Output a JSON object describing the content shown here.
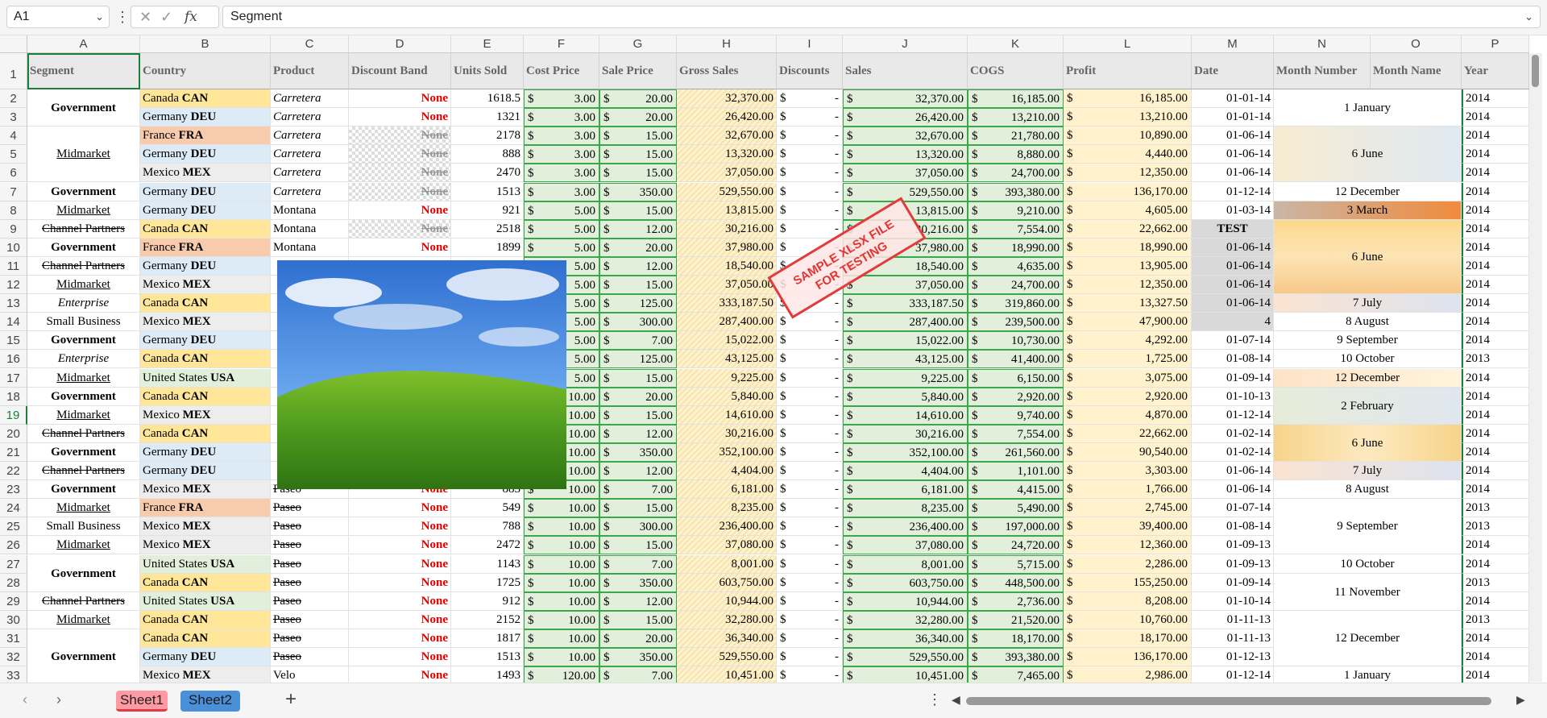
{
  "formula_bar": {
    "name_box": "A1",
    "formula": "Segment",
    "fx_label": "fx",
    "cancel_icon": "close-icon",
    "confirm_icon": "check-icon"
  },
  "columns": [
    "A",
    "B",
    "C",
    "D",
    "E",
    "F",
    "G",
    "H",
    "I",
    "J",
    "K",
    "L",
    "M",
    "N",
    "O",
    "P"
  ],
  "headers": [
    "Segment",
    "Country",
    "Product",
    "Discount Band",
    "Units Sold",
    "Cost Price",
    "Sale Price",
    "Gross Sales",
    "Discounts",
    "Sales",
    "COGS",
    "Profit",
    "Date",
    "Month Number",
    "Month Name",
    "Year"
  ],
  "rows": [
    {
      "n": "2",
      "seg": "Government",
      "country": "Canada",
      "code": "CAN",
      "product": "Carretera",
      "band": "None",
      "units": "1618.5",
      "cost": "3.00",
      "sale": "20.00",
      "gross": "32,370.00",
      "disc": "-",
      "sales": "32,370.00",
      "cogs": "16,185.00",
      "profit": "16,185.00",
      "date": "01-01-14",
      "year": "2014"
    },
    {
      "n": "3",
      "seg": "",
      "country": "Germany",
      "code": "DEU",
      "product": "Carretera",
      "band": "None",
      "units": "1321",
      "cost": "3.00",
      "sale": "20.00",
      "gross": "26,420.00",
      "disc": "-",
      "sales": "26,420.00",
      "cogs": "13,210.00",
      "profit": "13,210.00",
      "date": "01-01-14",
      "year": "2014"
    },
    {
      "n": "4",
      "seg": "",
      "country": "France",
      "code": "FRA",
      "product": "Carretera",
      "band": "None",
      "units": "2178",
      "cost": "3.00",
      "sale": "15.00",
      "gross": "32,670.00",
      "disc": "-",
      "sales": "32,670.00",
      "cogs": "21,780.00",
      "profit": "10,890.00",
      "date": "01-06-14",
      "year": "2014"
    },
    {
      "n": "5",
      "seg": "Midmarket",
      "country": "Germany",
      "code": "DEU",
      "product": "Carretera",
      "band": "None",
      "units": "888",
      "cost": "3.00",
      "sale": "15.00",
      "gross": "13,320.00",
      "disc": "-",
      "sales": "13,320.00",
      "cogs": "8,880.00",
      "profit": "4,440.00",
      "date": "01-06-14",
      "year": "2014"
    },
    {
      "n": "6",
      "seg": "",
      "country": "Mexico",
      "code": "MEX",
      "product": "Carretera",
      "band": "None",
      "units": "2470",
      "cost": "3.00",
      "sale": "15.00",
      "gross": "37,050.00",
      "disc": "-",
      "sales": "37,050.00",
      "cogs": "24,700.00",
      "profit": "12,350.00",
      "date": "01-06-14",
      "year": "2014"
    },
    {
      "n": "7",
      "seg": "Government",
      "country": "Germany",
      "code": "DEU",
      "product": "Carretera",
      "band": "None",
      "units": "1513",
      "cost": "3.00",
      "sale": "350.00",
      "gross": "529,550.00",
      "disc": "-",
      "sales": "529,550.00",
      "cogs": "393,380.00",
      "profit": "136,170.00",
      "date": "01-12-14",
      "year": "2014"
    },
    {
      "n": "8",
      "seg": "Midmarket",
      "country": "Germany",
      "code": "DEU",
      "product": "Montana",
      "band": "None",
      "units": "921",
      "cost": "5.00",
      "sale": "15.00",
      "gross": "13,815.00",
      "disc": "-",
      "sales": "13,815.00",
      "cogs": "9,210.00",
      "profit": "4,605.00",
      "date": "01-03-14",
      "year": "2014"
    },
    {
      "n": "9",
      "seg": "Channel Partners",
      "country": "Canada",
      "code": "CAN",
      "product": "Montana",
      "band": "None",
      "units": "2518",
      "cost": "5.00",
      "sale": "12.00",
      "gross": "30,216.00",
      "disc": "-",
      "sales": "30,216.00",
      "cogs": "7,554.00",
      "profit": "22,662.00",
      "date": "TEST",
      "year": "2014"
    },
    {
      "n": "10",
      "seg": "Government",
      "country": "France",
      "code": "FRA",
      "product": "Montana",
      "band": "None",
      "units": "1899",
      "cost": "5.00",
      "sale": "20.00",
      "gross": "37,980.00",
      "disc": "-",
      "sales": "37,980.00",
      "cogs": "18,990.00",
      "profit": "18,990.00",
      "date": "01-06-14",
      "year": "2014"
    },
    {
      "n": "11",
      "seg": "Channel Partners",
      "country": "Germany",
      "code": "DEU",
      "product": "",
      "band": "",
      "units": "",
      "cost": "5.00",
      "sale": "12.00",
      "gross": "18,540.00",
      "disc": "-",
      "sales": "18,540.00",
      "cogs": "4,635.00",
      "profit": "13,905.00",
      "date": "01-06-14",
      "year": "2014"
    },
    {
      "n": "12",
      "seg": "Midmarket",
      "country": "Mexico",
      "code": "MEX",
      "product": "",
      "band": "",
      "units": "",
      "cost": "5.00",
      "sale": "15.00",
      "gross": "37,050.00",
      "disc": "-",
      "sales": "37,050.00",
      "cogs": "24,700.00",
      "profit": "12,350.00",
      "date": "01-06-14",
      "year": "2014"
    },
    {
      "n": "13",
      "seg": "Enterprise",
      "country": "Canada",
      "code": "CAN",
      "product": "",
      "band": "",
      "units": "",
      "cost": "5.00",
      "sale": "125.00",
      "gross": "333,187.50",
      "disc": "-",
      "sales": "333,187.50",
      "cogs": "319,860.00",
      "profit": "13,327.50",
      "date": "01-06-14",
      "year": "2014"
    },
    {
      "n": "14",
      "seg": "Small Business",
      "country": "Mexico",
      "code": "MEX",
      "product": "",
      "band": "",
      "units": "",
      "cost": "5.00",
      "sale": "300.00",
      "gross": "287,400.00",
      "disc": "-",
      "sales": "287,400.00",
      "cogs": "239,500.00",
      "profit": "47,900.00",
      "date": "4",
      "year": "2014"
    },
    {
      "n": "15",
      "seg": "Government",
      "country": "Germany",
      "code": "DEU",
      "product": "",
      "band": "",
      "units": "",
      "cost": "5.00",
      "sale": "7.00",
      "gross": "15,022.00",
      "disc": "-",
      "sales": "15,022.00",
      "cogs": "10,730.00",
      "profit": "4,292.00",
      "date": "01-07-14",
      "year": "2014"
    },
    {
      "n": "16",
      "seg": "Enterprise",
      "country": "Canada",
      "code": "CAN",
      "product": "",
      "band": "",
      "units": "",
      "cost": "5.00",
      "sale": "125.00",
      "gross": "43,125.00",
      "disc": "-",
      "sales": "43,125.00",
      "cogs": "41,400.00",
      "profit": "1,725.00",
      "date": "01-08-14",
      "year": "2013"
    },
    {
      "n": "17",
      "seg": "Midmarket",
      "country": "United States",
      "code": "USA",
      "product": "",
      "band": "",
      "units": "",
      "cost": "5.00",
      "sale": "15.00",
      "gross": "9,225.00",
      "disc": "-",
      "sales": "9,225.00",
      "cogs": "6,150.00",
      "profit": "3,075.00",
      "date": "01-09-14",
      "year": "2014"
    },
    {
      "n": "18",
      "seg": "Government",
      "country": "Canada",
      "code": "CAN",
      "product": "",
      "band": "",
      "units": "",
      "cost": "10.00",
      "sale": "20.00",
      "gross": "5,840.00",
      "disc": "-",
      "sales": "5,840.00",
      "cogs": "2,920.00",
      "profit": "2,920.00",
      "date": "01-10-13",
      "year": "2014"
    },
    {
      "n": "19",
      "seg": "Midmarket",
      "country": "Mexico",
      "code": "MEX",
      "product": "",
      "band": "",
      "units": "",
      "cost": "10.00",
      "sale": "15.00",
      "gross": "14,610.00",
      "disc": "-",
      "sales": "14,610.00",
      "cogs": "9,740.00",
      "profit": "4,870.00",
      "date": "01-12-14",
      "year": "2014"
    },
    {
      "n": "20",
      "seg": "Channel Partners",
      "country": "Canada",
      "code": "CAN",
      "product": "",
      "band": "",
      "units": "",
      "cost": "10.00",
      "sale": "12.00",
      "gross": "30,216.00",
      "disc": "-",
      "sales": "30,216.00",
      "cogs": "7,554.00",
      "profit": "22,662.00",
      "date": "01-02-14",
      "year": "2014"
    },
    {
      "n": "21",
      "seg": "Government",
      "country": "Germany",
      "code": "DEU",
      "product": "",
      "band": "",
      "units": "",
      "cost": "10.00",
      "sale": "350.00",
      "gross": "352,100.00",
      "disc": "-",
      "sales": "352,100.00",
      "cogs": "261,560.00",
      "profit": "90,540.00",
      "date": "01-02-14",
      "year": "2014"
    },
    {
      "n": "22",
      "seg": "Channel Partners",
      "country": "Germany",
      "code": "DEU",
      "product": "",
      "band": "",
      "units": "",
      "cost": "10.00",
      "sale": "12.00",
      "gross": "4,404.00",
      "disc": "-",
      "sales": "4,404.00",
      "cogs": "1,101.00",
      "profit": "3,303.00",
      "date": "01-06-14",
      "year": "2014"
    },
    {
      "n": "23",
      "seg": "Government",
      "country": "Mexico",
      "code": "MEX",
      "product": "Paseo",
      "band": "None",
      "units": "883",
      "cost": "10.00",
      "sale": "7.00",
      "gross": "6,181.00",
      "disc": "-",
      "sales": "6,181.00",
      "cogs": "4,415.00",
      "profit": "1,766.00",
      "date": "01-06-14",
      "year": "2014"
    },
    {
      "n": "24",
      "seg": "Midmarket",
      "country": "France",
      "code": "FRA",
      "product": "Paseo",
      "band": "None",
      "units": "549",
      "cost": "10.00",
      "sale": "15.00",
      "gross": "8,235.00",
      "disc": "-",
      "sales": "8,235.00",
      "cogs": "5,490.00",
      "profit": "2,745.00",
      "date": "01-07-14",
      "year": "2013"
    },
    {
      "n": "25",
      "seg": "Small Business",
      "country": "Mexico",
      "code": "MEX",
      "product": "Paseo",
      "band": "None",
      "units": "788",
      "cost": "10.00",
      "sale": "300.00",
      "gross": "236,400.00",
      "disc": "-",
      "sales": "236,400.00",
      "cogs": "197,000.00",
      "profit": "39,400.00",
      "date": "01-08-14",
      "year": "2013"
    },
    {
      "n": "26",
      "seg": "Midmarket",
      "country": "Mexico",
      "code": "MEX",
      "product": "Paseo",
      "band": "None",
      "units": "2472",
      "cost": "10.00",
      "sale": "15.00",
      "gross": "37,080.00",
      "disc": "-",
      "sales": "37,080.00",
      "cogs": "24,720.00",
      "profit": "12,360.00",
      "date": "01-09-13",
      "year": "2014"
    },
    {
      "n": "27",
      "seg": "",
      "country": "United States",
      "code": "USA",
      "product": "Paseo",
      "band": "None",
      "units": "1143",
      "cost": "10.00",
      "sale": "7.00",
      "gross": "8,001.00",
      "disc": "-",
      "sales": "8,001.00",
      "cogs": "5,715.00",
      "profit": "2,286.00",
      "date": "01-09-13",
      "year": "2014"
    },
    {
      "n": "28",
      "seg": "",
      "country": "Canada",
      "code": "CAN",
      "product": "Paseo",
      "band": "None",
      "units": "1725",
      "cost": "10.00",
      "sale": "350.00",
      "gross": "603,750.00",
      "disc": "-",
      "sales": "603,750.00",
      "cogs": "448,500.00",
      "profit": "155,250.00",
      "date": "01-09-14",
      "year": "2013"
    },
    {
      "n": "29",
      "seg": "Channel Partners",
      "country": "United States",
      "code": "USA",
      "product": "Paseo",
      "band": "None",
      "units": "912",
      "cost": "10.00",
      "sale": "12.00",
      "gross": "10,944.00",
      "disc": "-",
      "sales": "10,944.00",
      "cogs": "2,736.00",
      "profit": "8,208.00",
      "date": "01-10-14",
      "year": "2014"
    },
    {
      "n": "30",
      "seg": "Midmarket",
      "country": "Canada",
      "code": "CAN",
      "product": "Paseo",
      "band": "None",
      "units": "2152",
      "cost": "10.00",
      "sale": "15.00",
      "gross": "32,280.00",
      "disc": "-",
      "sales": "32,280.00",
      "cogs": "21,520.00",
      "profit": "10,760.00",
      "date": "01-11-13",
      "year": "2013"
    },
    {
      "n": "31",
      "seg": "",
      "country": "Canada",
      "code": "CAN",
      "product": "Paseo",
      "band": "None",
      "units": "1817",
      "cost": "10.00",
      "sale": "20.00",
      "gross": "36,340.00",
      "disc": "-",
      "sales": "36,340.00",
      "cogs": "18,170.00",
      "profit": "18,170.00",
      "date": "01-11-13",
      "year": "2014"
    },
    {
      "n": "32",
      "seg": "",
      "country": "Germany",
      "code": "DEU",
      "product": "Paseo",
      "band": "None",
      "units": "1513",
      "cost": "10.00",
      "sale": "350.00",
      "gross": "529,550.00",
      "disc": "-",
      "sales": "529,550.00",
      "cogs": "393,380.00",
      "profit": "136,170.00",
      "date": "01-12-13",
      "year": "2014"
    },
    {
      "n": "33",
      "seg": "",
      "country": "Mexico",
      "code": "MEX",
      "product": "Velo",
      "band": "None",
      "units": "1493",
      "cost": "120.00",
      "sale": "7.00",
      "gross": "10,451.00",
      "disc": "-",
      "sales": "10,451.00",
      "cogs": "7,465.00",
      "profit": "2,986.00",
      "date": "01-12-14",
      "year": "2014"
    }
  ],
  "merged_segments": [
    {
      "text": "Government",
      "from": 2,
      "to": 3
    },
    {
      "text": "Midmarket",
      "from": 4,
      "to": 6
    },
    {
      "text": "Government",
      "from": 27,
      "to": 28
    },
    {
      "text": "Government",
      "from": 31,
      "to": 33
    }
  ],
  "months": [
    {
      "text": "1 January",
      "from": 2,
      "to": 3
    },
    {
      "text": "6 June",
      "from": 4,
      "to": 6
    },
    {
      "text": "12 December",
      "from": 7,
      "to": 7
    },
    {
      "text": "3 March",
      "from": 8,
      "to": 8
    },
    {
      "text": "6 June",
      "from": 9,
      "to": 12
    },
    {
      "text": "7 July",
      "from": 13,
      "to": 13
    },
    {
      "text": "8 August",
      "from": 14,
      "to": 14
    },
    {
      "text": "9 September",
      "from": 15,
      "to": 15
    },
    {
      "text": "10 October",
      "from": 16,
      "to": 16
    },
    {
      "text": "12 December",
      "from": 17,
      "to": 17
    },
    {
      "text": "2 February",
      "from": 18,
      "to": 19
    },
    {
      "text": "6 June",
      "from": 20,
      "to": 21
    },
    {
      "text": "7 July",
      "from": 22,
      "to": 22
    },
    {
      "text": "8 August",
      "from": 23,
      "to": 23
    },
    {
      "text": "9 September",
      "from": 24,
      "to": 26
    },
    {
      "text": "10 October",
      "from": 27,
      "to": 27
    },
    {
      "text": "11 November",
      "from": 28,
      "to": 29
    },
    {
      "text": "12 December",
      "from": 30,
      "to": 32
    },
    {
      "text": "1 January",
      "from": 33,
      "to": 33
    }
  ],
  "currency_symbol": "$",
  "stamp": {
    "line1": "SAMPLE XLSX FILE",
    "line2": "FOR TESTING"
  },
  "photo_icon": "landscape-image",
  "colors": {
    "canada": "#ffe699",
    "germany": "#ddebf7",
    "france": "#f8cbad",
    "mexico": "#ededed",
    "usa": "#e2efda",
    "green": "#e2efda",
    "green_border": "#3aa84a",
    "yellow": "#fff2cc",
    "red_text": "#e00000",
    "stamp_red": "#e23b3b"
  },
  "sheets": [
    {
      "label": "Sheet1"
    },
    {
      "label": "Sheet2"
    }
  ],
  "add_sheet": "+"
}
